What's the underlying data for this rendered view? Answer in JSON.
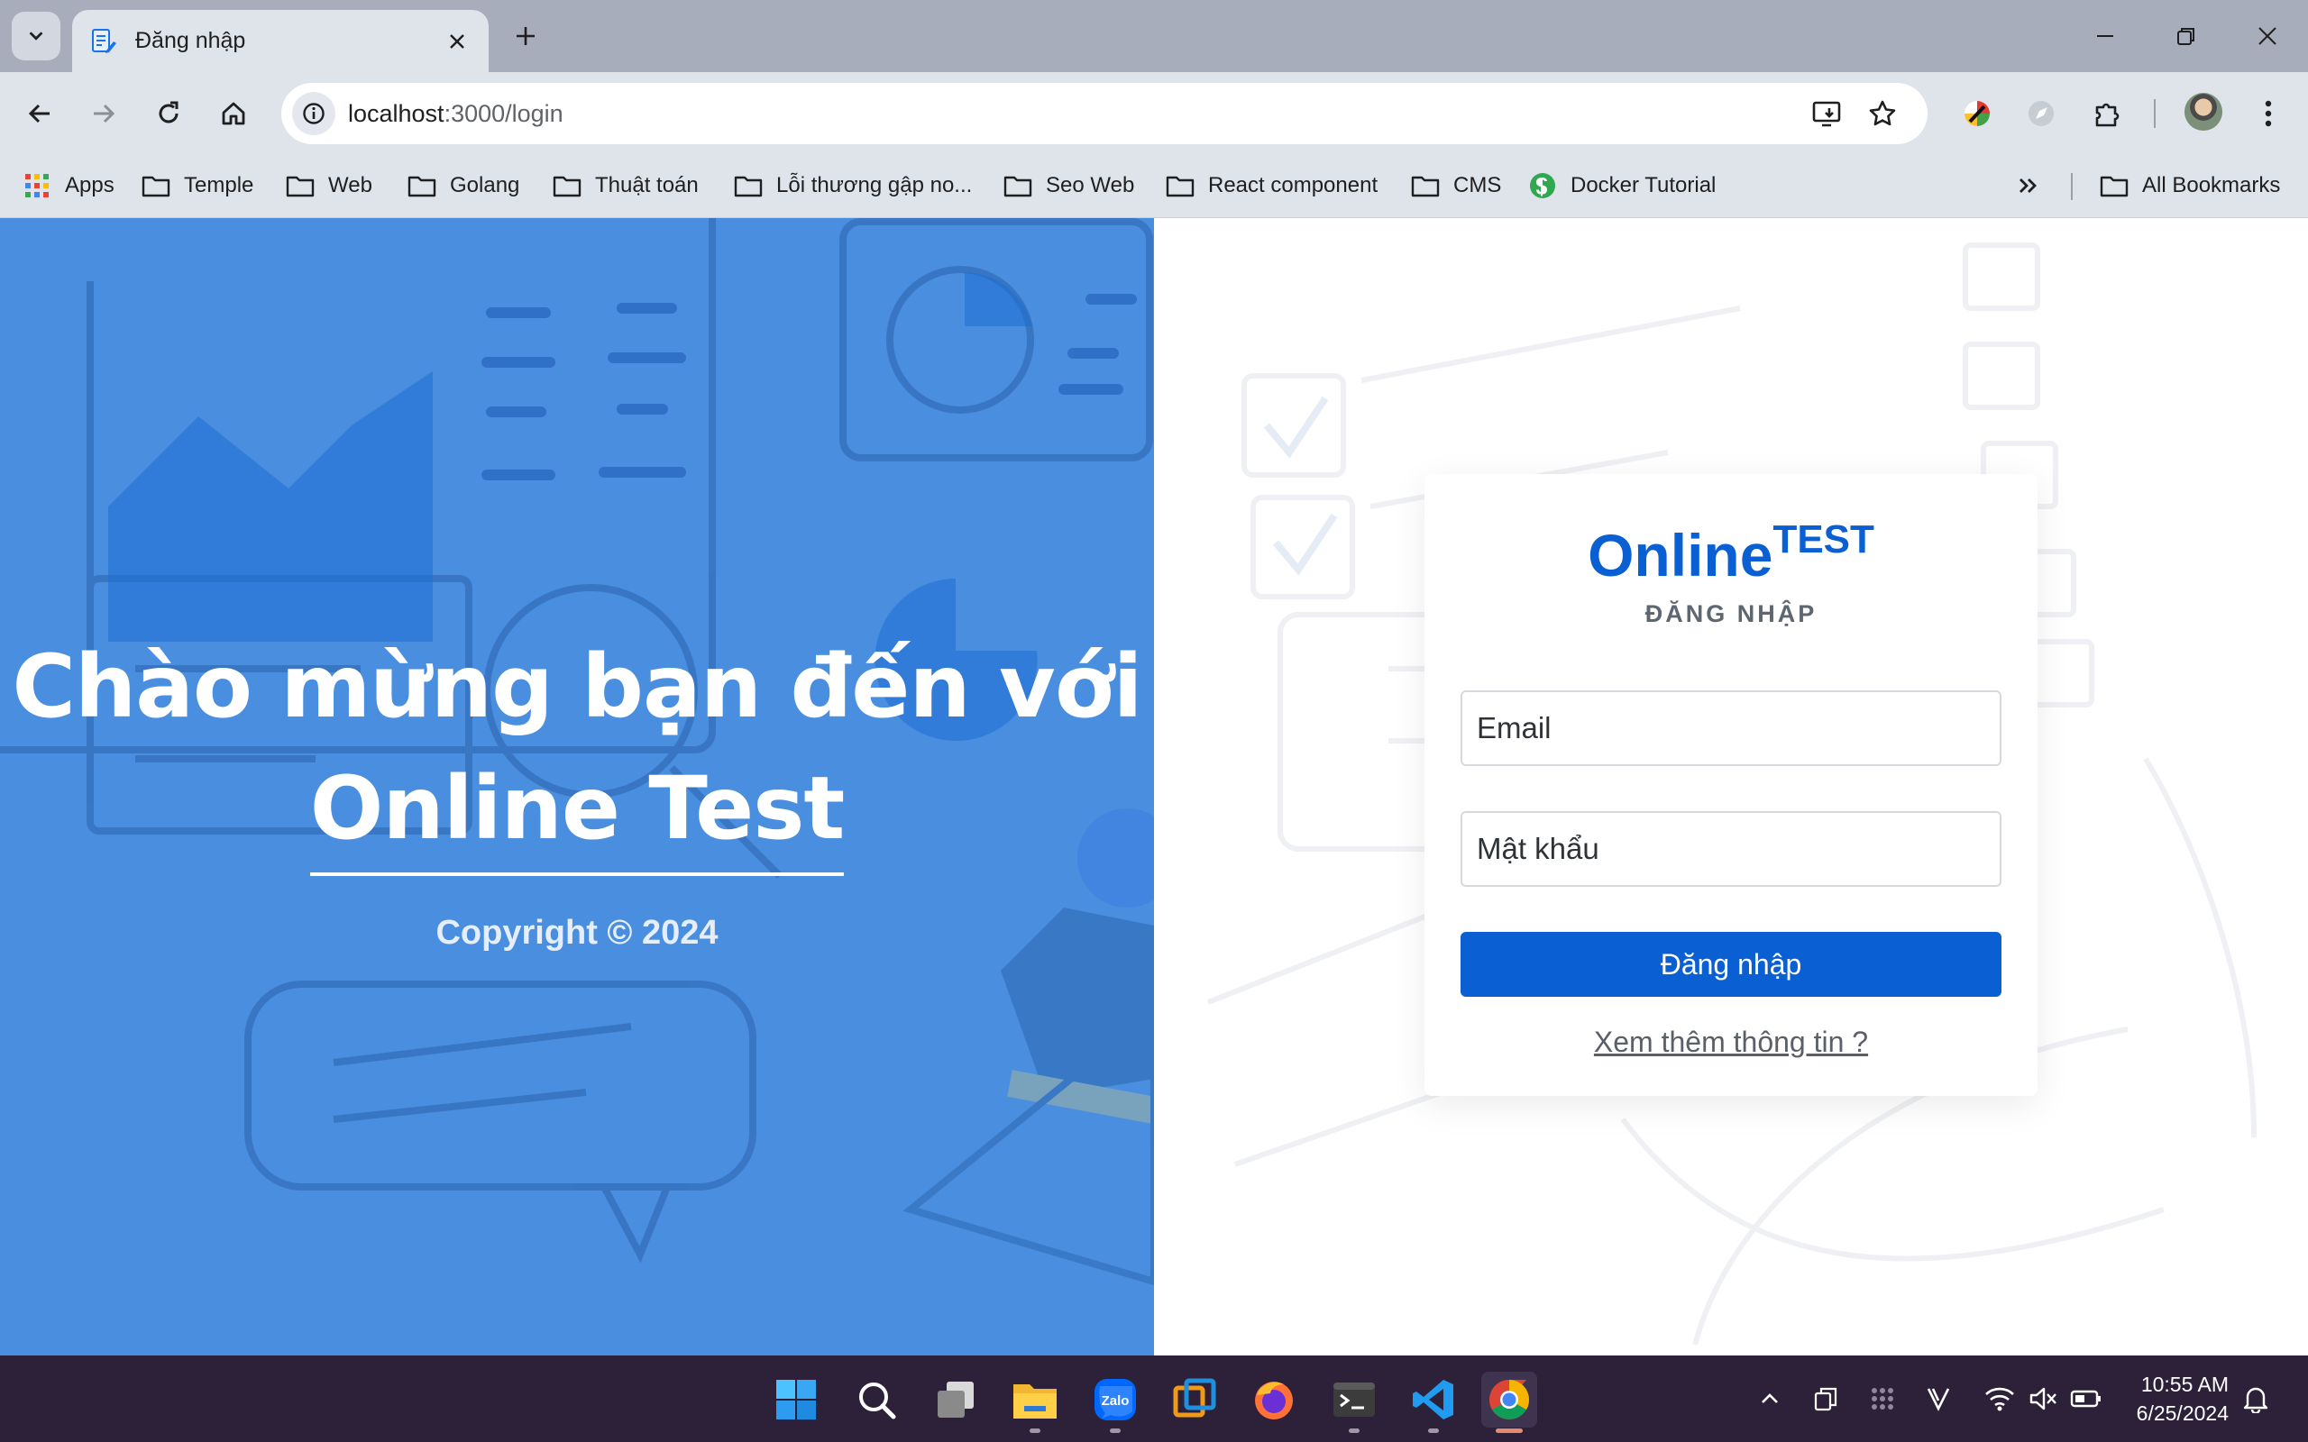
{
  "browser": {
    "tab": {
      "title": "Đăng nhập"
    },
    "url": {
      "host": "localhost",
      "path": ":3000/login"
    },
    "bookmarks": [
      {
        "label": "Apps",
        "icon": "apps-grid-icon"
      },
      {
        "label": "Temple",
        "icon": "folder-icon"
      },
      {
        "label": "Web",
        "icon": "folder-icon"
      },
      {
        "label": "Golang",
        "icon": "folder-icon"
      },
      {
        "label": "Thuật toán",
        "icon": "folder-icon"
      },
      {
        "label": "Lỗi thương gập no...",
        "icon": "folder-icon"
      },
      {
        "label": "Seo Web",
        "icon": "folder-icon"
      },
      {
        "label": "React component",
        "icon": "folder-icon"
      },
      {
        "label": "CMS",
        "icon": "folder-icon"
      },
      {
        "label": "Docker Tutorial",
        "icon": "docker-tutorial-icon"
      }
    ],
    "all_bookmarks": "All Bookmarks"
  },
  "hero": {
    "title_line1": "Chào mừng bạn đến với",
    "title_line2": "Online Test",
    "copyright": "Copyright © 2024"
  },
  "login": {
    "logo_main": "Online",
    "logo_sup": "TEST",
    "subtitle": "ĐĂNG NHẬP",
    "email_placeholder": "Email",
    "password_placeholder": "Mật khẩu",
    "submit_label": "Đăng nhập",
    "more_link": "Xem thêm thông tin ?"
  },
  "taskbar": {
    "apps": [
      "windows-start-icon",
      "search-icon",
      "task-view-icon",
      "file-explorer-icon",
      "zalo-icon",
      "app-icon",
      "firefox-icon",
      "terminal-icon",
      "vscode-icon",
      "chrome-icon"
    ],
    "zalo_label": "Zalo",
    "time": "10:55 AM",
    "date": "6/25/2024"
  },
  "colors": {
    "brand": "#0a60d2",
    "hero_bg": "#4a8ee0",
    "taskbar_bg": "#2c2138"
  }
}
